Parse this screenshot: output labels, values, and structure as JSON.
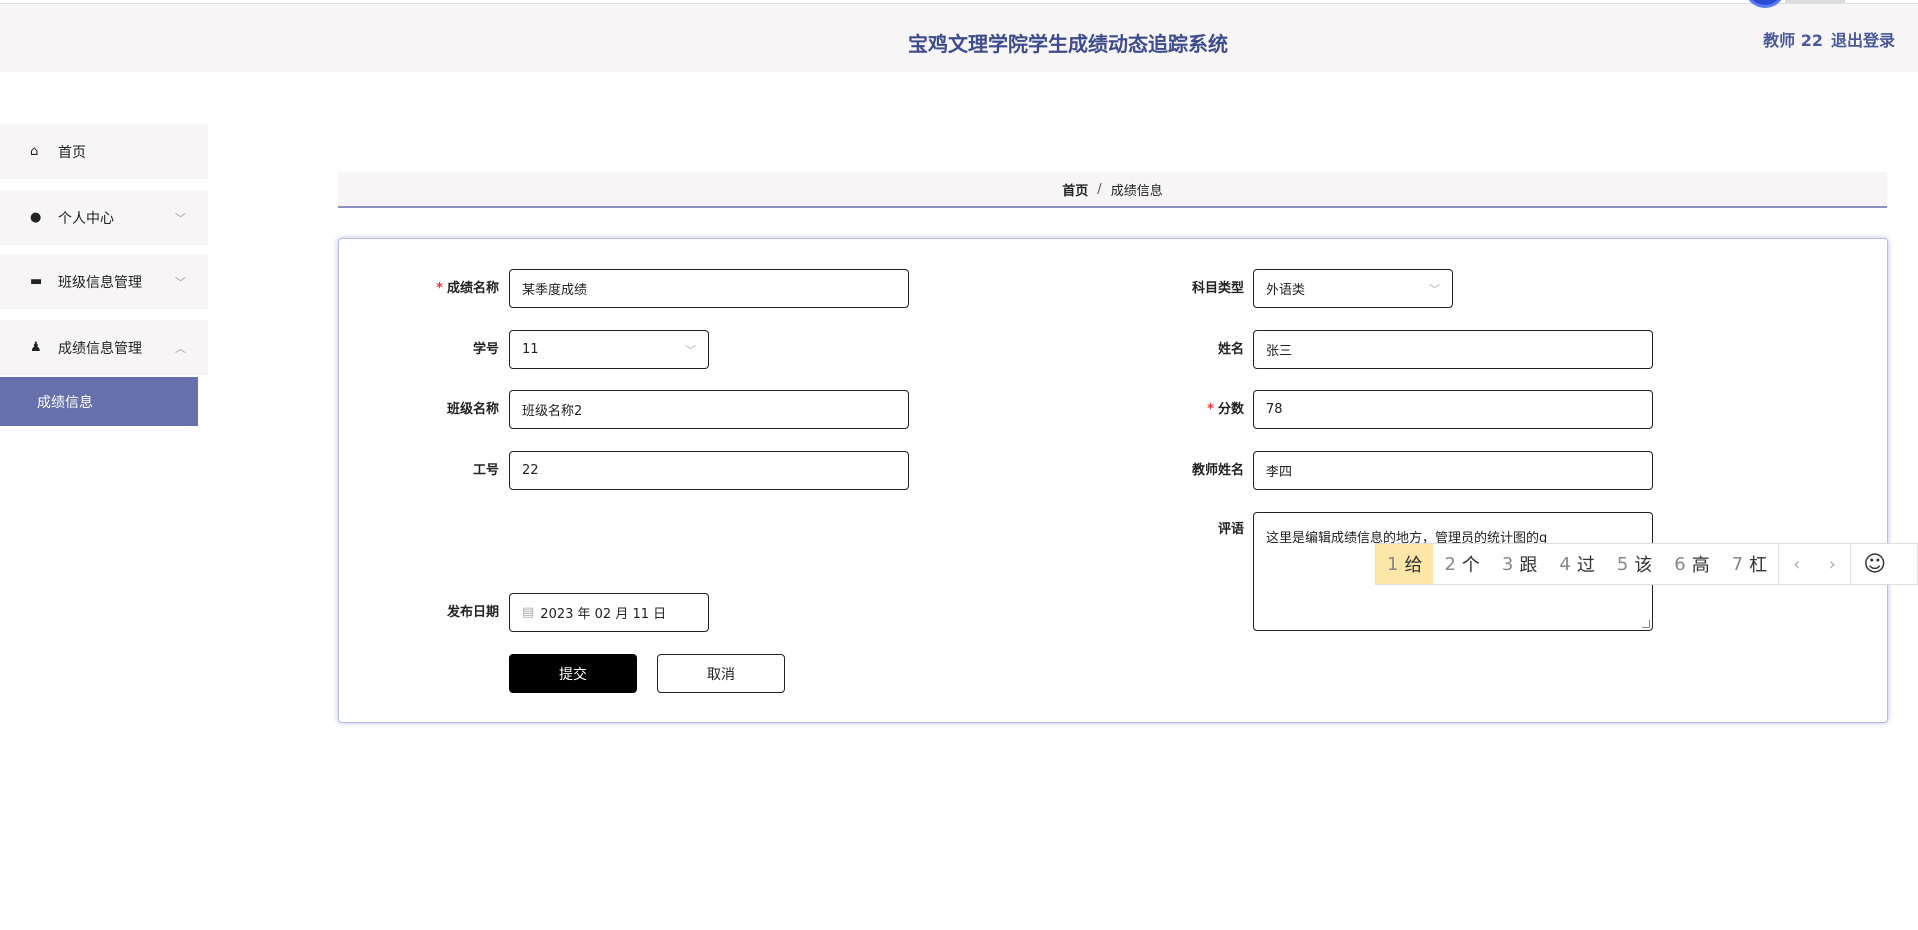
{
  "header": {
    "title": "宝鸡文理学院学生成绩动态追踪系统",
    "user": "教师 22",
    "logout": "退出登录"
  },
  "sidebar": {
    "items": [
      {
        "label": "首页",
        "icon": "home-icon"
      },
      {
        "label": "个人中心",
        "icon": "user-icon"
      },
      {
        "label": "班级信息管理",
        "icon": "briefcase-icon"
      },
      {
        "label": "成绩信息管理",
        "icon": "user-stamp-icon"
      }
    ],
    "sub_item": "成绩信息"
  },
  "breadcrumb": {
    "home": "首页",
    "sep": "/",
    "current": "成绩信息"
  },
  "form": {
    "score_name": {
      "label": "成绩名称",
      "value": "某季度成绩",
      "required": true
    },
    "subject_type": {
      "label": "科目类型",
      "value": "外语类"
    },
    "student_no": {
      "label": "学号",
      "value": "11"
    },
    "name": {
      "label": "姓名",
      "value": "张三"
    },
    "class_name": {
      "label": "班级名称",
      "value": "班级名称2"
    },
    "score": {
      "label": "分数",
      "value": "78",
      "required": true
    },
    "staff_no": {
      "label": "工号",
      "value": "22"
    },
    "teacher_name": {
      "label": "教师姓名",
      "value": "李四"
    },
    "comment": {
      "label": "评语",
      "value": "这里是编辑成绩信息的地方，管理员的统计图的g"
    },
    "publish_date": {
      "label": "发布日期",
      "value": "2023 年 02 月 11 日"
    },
    "submit": "提交",
    "cancel": "取消",
    "required_mark": "*"
  },
  "ime": {
    "candidates": [
      {
        "n": "1",
        "c": "给"
      },
      {
        "n": "2",
        "c": "个"
      },
      {
        "n": "3",
        "c": "跟"
      },
      {
        "n": "4",
        "c": "过"
      },
      {
        "n": "5",
        "c": "该"
      },
      {
        "n": "6",
        "c": "高"
      },
      {
        "n": "7",
        "c": "杠"
      }
    ],
    "prev": "‹",
    "next": "›",
    "emoji": "☺"
  },
  "colors": {
    "accent": "#6670ac",
    "title": "#3d4c8c"
  }
}
